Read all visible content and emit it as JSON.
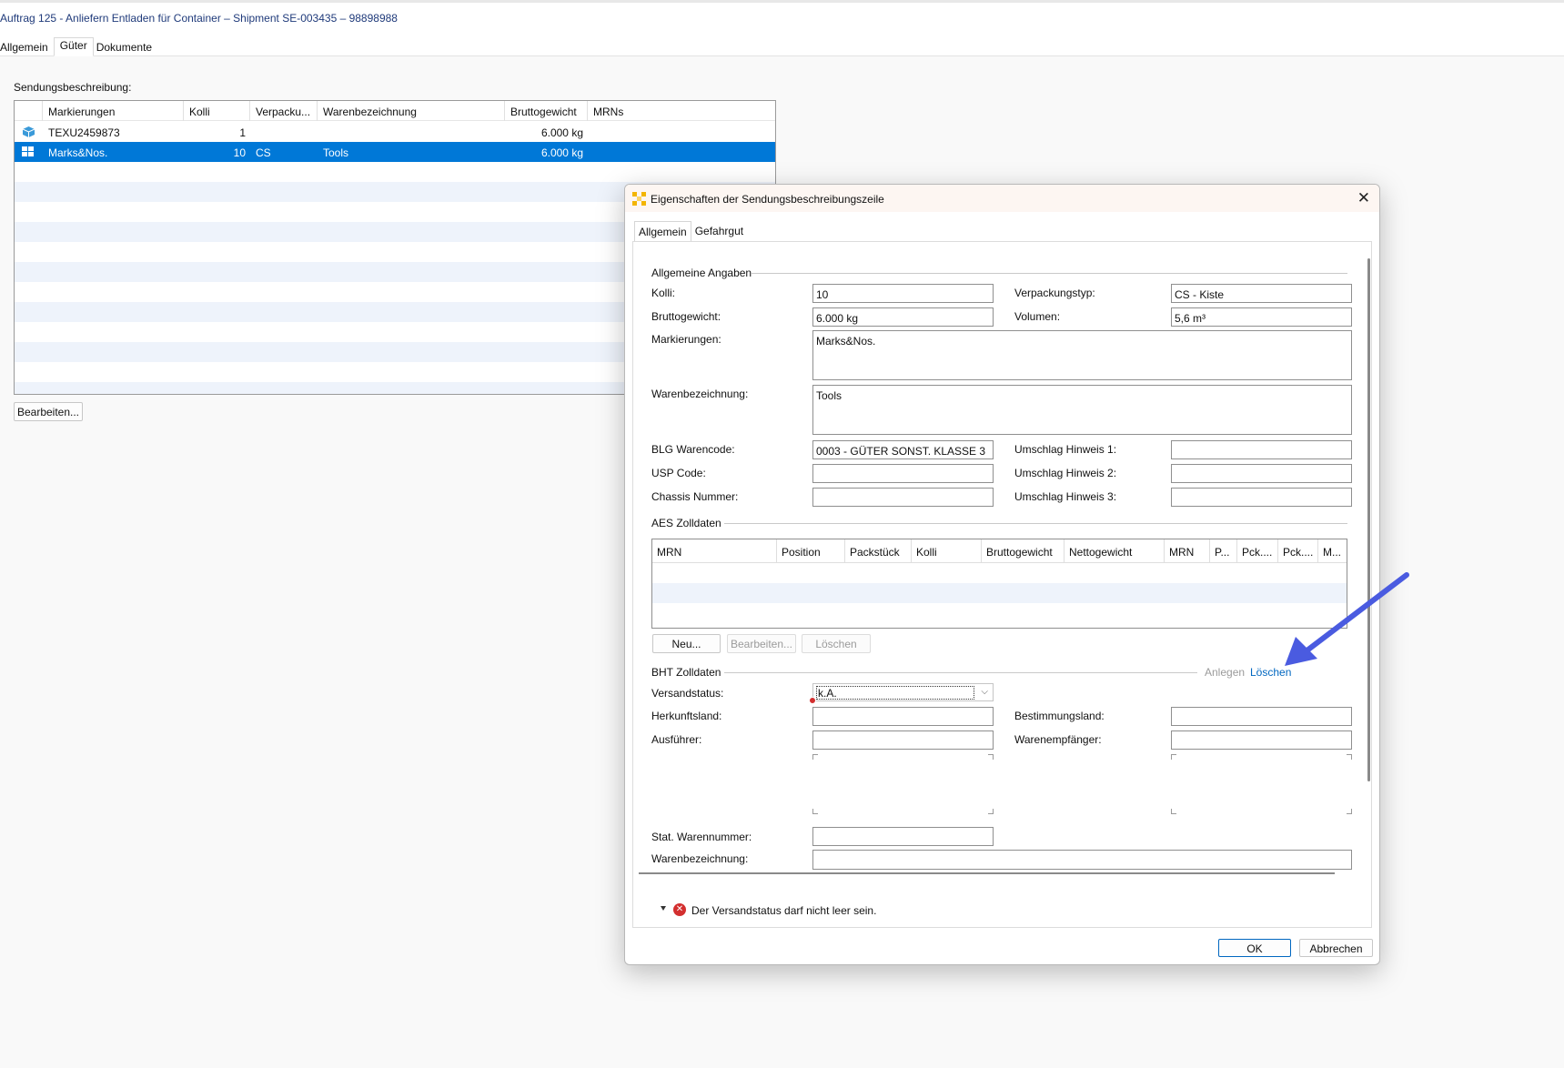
{
  "window": {
    "title": "Auftrag 125 - Anliefern Entladen für Container – Shipment SE-003435 – 98898988",
    "tabs": [
      "Allgemein",
      "Güter",
      "Dokumente"
    ]
  },
  "main": {
    "section_label": "Sendungsbeschreibung:",
    "columns": [
      "Markierungen",
      "Kolli",
      "Verpacku...",
      "Warenbezeichnung",
      "Bruttogewicht",
      "MRNs"
    ],
    "rows": [
      {
        "icon": "container-icon",
        "markierungen": "TEXU2459873",
        "kolli": "1",
        "verpackung": "",
        "warenbezeichnung": "",
        "bruttogewicht": "6.000 kg",
        "mrns": ""
      },
      {
        "icon": "grid-icon",
        "markierungen": "Marks&Nos.",
        "kolli": "10",
        "verpackung": "CS",
        "warenbezeichnung": "Tools",
        "bruttogewicht": "6.000 kg",
        "mrns": ""
      }
    ],
    "edit_button": "Bearbeiten..."
  },
  "dialog": {
    "title": "Eigenschaften der Sendungsbeschreibungszeile",
    "close": "✕",
    "tabs": [
      "Allgemein",
      "Gefahrgut"
    ],
    "general": {
      "section": "Allgemeine Angaben",
      "kolli_label": "Kolli:",
      "kolli": "10",
      "verpackungstyp_label": "Verpackungstyp:",
      "verpackungstyp": "CS - Kiste",
      "bruttogewicht_label": "Bruttogewicht:",
      "bruttogewicht": "6.000 kg",
      "volumen_label": "Volumen:",
      "volumen": "5,6 m³",
      "markierungen_label": "Markierungen:",
      "markierungen": "Marks&Nos.",
      "warenbezeichnung_label": "Warenbezeichnung:",
      "warenbezeichnung": "Tools",
      "blg_label": "BLG Warencode:",
      "blg": "0003 - GÜTER SONST. KLASSE 3",
      "usp_label": "USP Code:",
      "usp": "",
      "chassis_label": "Chassis Nummer:",
      "chassis": "",
      "umschlag1_label": "Umschlag Hinweis 1:",
      "umschlag1": "",
      "umschlag2_label": "Umschlag Hinweis 2:",
      "umschlag2": "",
      "umschlag3_label": "Umschlag Hinweis 3:",
      "umschlag3": ""
    },
    "aes": {
      "section": "AES Zolldaten",
      "columns": [
        "MRN",
        "Position",
        "Packstück",
        "Kolli",
        "Bruttogewicht",
        "Nettogewicht",
        "MRN",
        "P...",
        "Pck....",
        "Pck....",
        "M..."
      ],
      "new_button": "Neu...",
      "edit_button": "Bearbeiten...",
      "delete_button": "Löschen"
    },
    "bht": {
      "section": "BHT Zolldaten",
      "create_link": "Anlegen",
      "delete_link": "Löschen",
      "versandstatus_label": "Versandstatus:",
      "versandstatus": "k.A.",
      "herkunftsland_label": "Herkunftsland:",
      "herkunftsland": "",
      "bestimmungsland_label": "Bestimmungsland:",
      "bestimmungsland": "",
      "ausfuehrer_label": "Ausführer:",
      "ausfuehrer": "",
      "warenempfaenger_label": "Warenempfänger:",
      "warenempfaenger": "",
      "stat_label": "Stat. Warennummer:",
      "stat": "",
      "warenbez_label": "Warenbezeichnung:",
      "warenbez": ""
    },
    "error": "Der Versandstatus darf nicht leer sein.",
    "ok_button": "OK",
    "cancel_button": "Abbrechen"
  },
  "colors": {
    "selection": "#0078d7",
    "title_text": "#1f3a7a",
    "link": "#0067c0",
    "arrow": "#4a5be0",
    "error": "#d32f2f"
  }
}
